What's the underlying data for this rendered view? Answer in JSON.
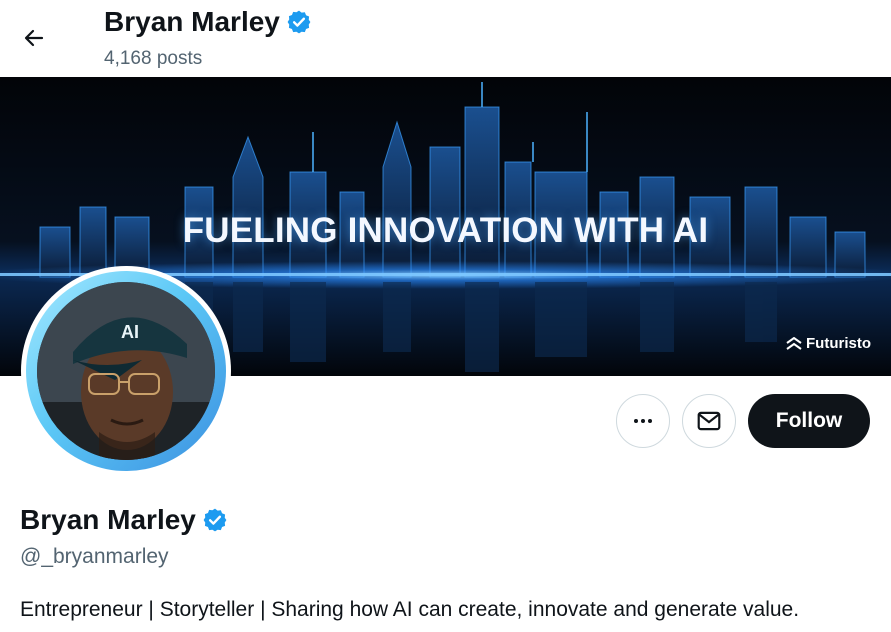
{
  "header": {
    "name": "Bryan Marley",
    "posts_count": "4,168 posts"
  },
  "banner": {
    "headline": "FUELING INNOVATION WITH AI",
    "brand": "Futuristo"
  },
  "avatar": {
    "cap_text": "AI"
  },
  "actions": {
    "follow_label": "Follow"
  },
  "profile": {
    "name": "Bryan Marley",
    "handle": "@_bryanmarley",
    "bio": "Entrepreneur | Storyteller | Sharing how AI can create, innovate and generate value."
  },
  "colors": {
    "verified": "#1d9bf0",
    "text_primary": "#0f1419",
    "text_secondary": "#536471",
    "follow_bg": "#0f1419",
    "banner_glow": "#2a8cff"
  }
}
